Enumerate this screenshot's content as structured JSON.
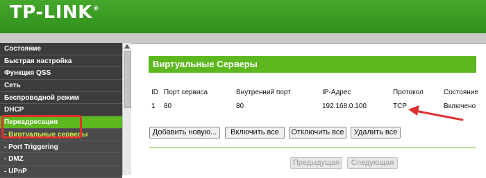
{
  "brand": {
    "name": "TP-LINK",
    "mark": "®"
  },
  "sidebar": {
    "items": [
      {
        "label": "Состояние"
      },
      {
        "label": "Быстрая настройка"
      },
      {
        "label": "Функция QSS"
      },
      {
        "label": "Сеть"
      },
      {
        "label": "Беспроводной режим"
      },
      {
        "label": "DHCP"
      },
      {
        "label": "Переадресация"
      },
      {
        "label": "- Виртуальные серверы"
      },
      {
        "label": "- Port Triggering"
      },
      {
        "label": "- DMZ"
      },
      {
        "label": "- UPnP"
      }
    ]
  },
  "main": {
    "section_title": "Виртуальные Серверы",
    "table": {
      "headers": [
        "ID",
        "Порт сервиса",
        "Внутренний порт",
        "IP-Адрес",
        "Протокол",
        "Состояние"
      ],
      "rows": [
        [
          "1",
          "80",
          "80",
          "192.168.0.100",
          "TCP",
          "Включено"
        ]
      ]
    },
    "buttons": {
      "add_new": "Добавить новую...",
      "enable_all": "Включить все",
      "disable_all": "Отключить все",
      "delete_all": "Удалить все",
      "prev": "Предыдущая",
      "next": "Следующая"
    }
  },
  "colors": {
    "brand_green": "#46a82c",
    "accent_green": "#5cb81e",
    "annotation_red": "#e03030"
  }
}
